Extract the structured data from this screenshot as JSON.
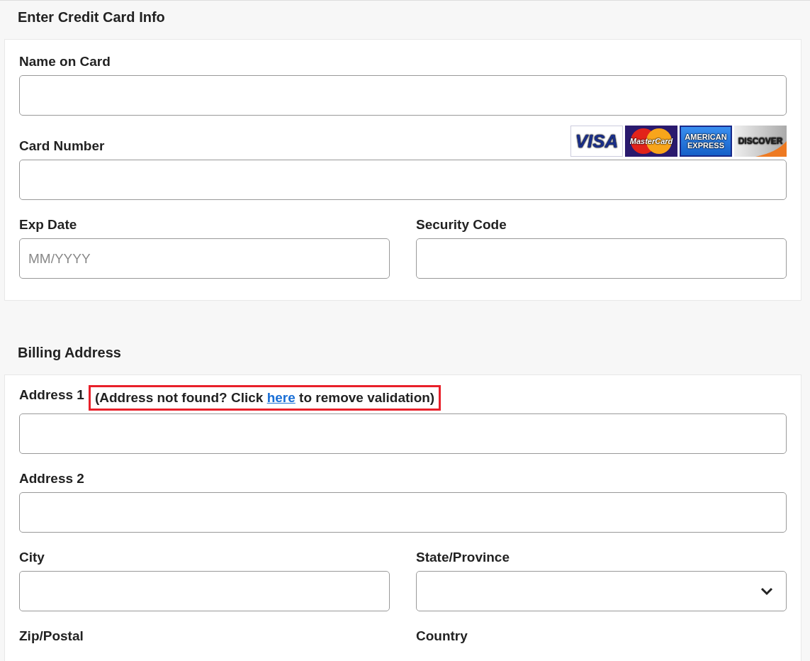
{
  "sections": [
    {
      "title": "Enter Credit Card Info",
      "rows": [
        [
          {
            "label": "Name on Card",
            "kind": "text"
          }
        ],
        [
          {
            "label": "Card Number",
            "kind": "text",
            "logos": [
              {
                "kind": "visa",
                "text": "VISA"
              },
              {
                "kind": "mastercard",
                "text": "MasterCard"
              },
              {
                "kind": "amex",
                "text": "AMERICAN EXPRESS"
              },
              {
                "kind": "discover",
                "text": "DISCOVER"
              }
            ]
          }
        ],
        [
          {
            "label": "Exp Date",
            "kind": "text",
            "placeholder": "MM/YYYY"
          },
          {
            "label": "Security Code",
            "kind": "text"
          }
        ]
      ]
    },
    {
      "title": "Billing Address",
      "rows": [
        [
          {
            "label": "Address 1",
            "kind": "text",
            "note": {
              "before": "(Address not found? Click ",
              "link": "here",
              "after": " to remove validation)",
              "highlighted": true
            }
          }
        ],
        [
          {
            "label": "Address 2",
            "kind": "text"
          }
        ],
        [
          {
            "label": "City",
            "kind": "text"
          },
          {
            "label": "State/Province",
            "kind": "select"
          }
        ],
        [
          {
            "label": "Zip/Postal",
            "kind": "none"
          },
          {
            "label": "Country",
            "kind": "none"
          }
        ]
      ]
    }
  ]
}
